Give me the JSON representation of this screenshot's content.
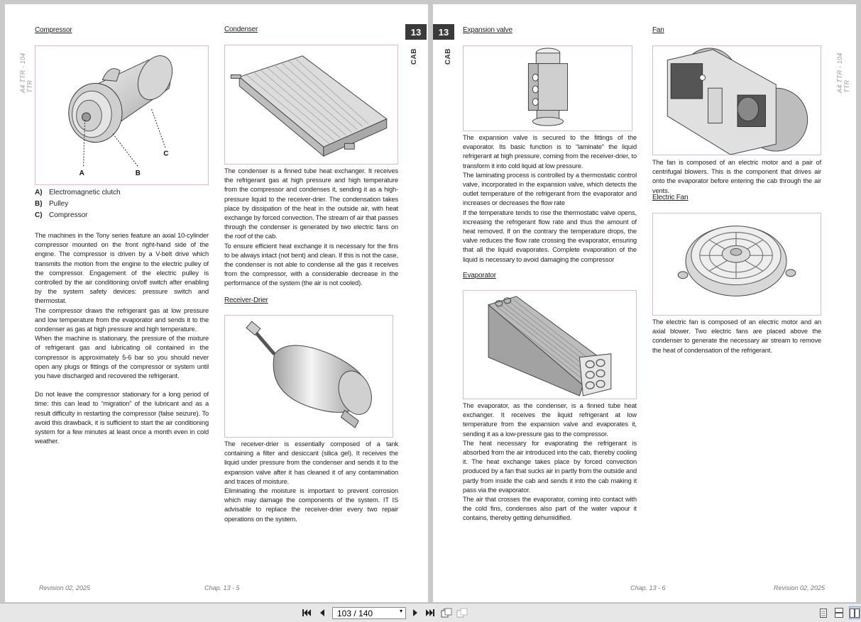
{
  "left_page": {
    "side_label": "A4 TTR - 104 TTR",
    "chapter_number": "13",
    "chapter_label": "CAB",
    "compressor": {
      "title": "Compressor",
      "callouts": [
        "A",
        "B",
        "C"
      ],
      "legend": [
        {
          "key": "A)",
          "text": "Electromagnetic clutch"
        },
        {
          "key": "B)",
          "text": "Pulley"
        },
        {
          "key": "C)",
          "text": "Compressor"
        }
      ],
      "paragraphs": [
        "The machines in the Tony series feature an axial 10-cylinder compressor mounted on the front right-hand side of the engine. The compressor is driven by a V-belt drive which transmits the motion from the engine to the electric pulley of the compressor. Engagement of the electric pulley is controlled by the air conditioning on/off switch after enabling by the system safety devices: pressure switch and thermostat.",
        "The compressor draws the refrigerant gas at low pressure and low temperature from the evaporator and sends it to the condenser as gas at high pressure and high temperature.",
        "When the machine is stationary, the pressure of the mixture of refrigerant gas and lubricating oil contained in the compressor is approximately 5-6 bar so you should never open any plugs or fittings of the compressor or system until you have discharged and recovered the refrigerant."
      ],
      "paragraph_2": "Do not leave the compressor stationary for a long period of time: this can lead to “migration” of the lubricant and as a result difficulty in restarting the compressor (false seizure). To avoid this drawback, it is sufficient to start the air conditioning system for a few minutes at least once a month even in cold weather."
    },
    "condenser": {
      "title": "Condenser",
      "paragraphs": [
        "The condenser is a finned tube heat exchanger. It receives the refrigerant gas at high pressure and high temperature from the compressor and condenses it, sending it as a high-pressure liquid to the receiver-drier. The condensation takes place by dissipation of the heat in the outside air, with heat exchange by forced convection. The stream of air that passes through the condenser is generated by two electric fans on the roof of the cab.",
        "To ensure efficient heat exchange it is necessary for the fins to be always intact (not bent) and clean. If this is not the case, the condenser is not able to condense all the gas it receives from the compressor, with a considerable decrease in the performance of the system (the air is not cooled)."
      ]
    },
    "receiver_drier": {
      "title": "Receiver-Drier",
      "paragraphs": [
        "The receiver-drier is essentially composed of a tank containing a filter and desiccant (silica gel). It receives the liquid under pressure from the condenser and sends it to the expansion valve after it has cleaned it of any contamination and traces of moisture.",
        "Eliminating the moisture is important to prevent corrosion which may damage the components of the system. IT IS advisable to replace the receiver-drier every two repair operations on the system."
      ]
    },
    "footer_revision": "Revision 02, 2025",
    "footer_chap": "Chap. 13 - 5"
  },
  "right_page": {
    "side_label": "A4 TTR - 104 TTR",
    "chapter_number": "13",
    "chapter_label": "CAB",
    "expansion_valve": {
      "title": "Expansion valve",
      "paragraphs": [
        "The expansion valve is secured to the fittings of the evaporator. Its basic function is to “laminate” the liquid refrigerant at high pressure, coming from the receiver-drier, to transform it into cold liquid at low pressure.",
        "The laminating process is controlled by a thermostatic control valve, incorporated in the expansion valve, which detects the outlet temperature of the refrigerant from the evaporator and increases or decreases the flow rate",
        "If the temperature tends to rise the thermostatic valve opens, increasing the refrigerant flow rate and thus the amount of heat removed. If on the contrary the temperature drops, the valve reduces the flow rate crossing the evaporator, ensuring that all the liquid evaporates. Complete evaporation of the liquid is necessary to avoid damaging the compressor"
      ]
    },
    "evaporator": {
      "title": "Evaporator",
      "paragraphs": [
        "The evaporator, as the condenser, is a finned tube heat exchanger. It receives the liquid refrigerant at low temperature from the expansion valve and evaporates it, sending it as a low-pressure gas to the compressor.",
        "The heat necessary for evaporating the refrigerant is absorbed from the air introduced into the cab, thereby cooling it. The heat exchange takes place by forced convection produced by a fan that sucks air in partly from the outside and partly from inside the cab and sends it into the cab making it pass via the evaporator.",
        "The air that crosses the evaporator, coming into contact with the cold fins, condenses also part of the water vapour it contains, thereby getting dehumidified."
      ]
    },
    "fan": {
      "title": "Fan",
      "paragraphs": [
        "The fan is composed of an electric motor and a pair of centrifugal blowers. This is the component that drives air onto the evaporator before entering the cab through the air vents."
      ]
    },
    "electric_fan": {
      "title": "Electric Fan",
      "paragraphs": [
        "The electric fan is composed of an electric motor and an axial blower. Two electric fans are placed above the condenser to generate the necessary air stream to remove the heat of condensation of the refrigerant."
      ]
    },
    "footer_chap": "Chap. 13 - 6",
    "footer_revision": "Revision 02, 2025"
  },
  "toolbar": {
    "first_icon": "skip-first-icon",
    "prev_icon": "prev-page-icon",
    "page_indicator": "103 / 140",
    "next_icon": "next-page-icon",
    "last_icon": "skip-last-icon",
    "view_icons": [
      "single-page-icon",
      "continuous-page-icon",
      "two-page-icon"
    ]
  }
}
